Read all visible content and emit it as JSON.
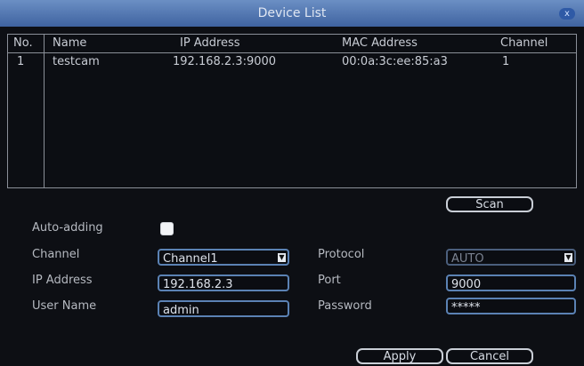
{
  "window": {
    "title": "Device List",
    "close_label": "x"
  },
  "table": {
    "headers": [
      "No.",
      "Name",
      "IP Address",
      "MAC Address",
      "Channel"
    ],
    "rows": [
      {
        "no": "1",
        "name": "testcam",
        "ip": "192.168.2.3:9000",
        "mac": "00:0a:3c:ee:85:a3",
        "channel": "1"
      }
    ]
  },
  "scan": {
    "label": "Scan"
  },
  "form": {
    "auto_adding_label": "Auto-adding",
    "channel_label": "Channel",
    "channel_value": "Channel1",
    "protocol_label": "Protocol",
    "protocol_value": "AUTO",
    "ip_label": "IP Address",
    "ip_value": "192.168.2.3",
    "port_label": "Port",
    "port_value": "9000",
    "user_label": "User Name",
    "user_value": "admin",
    "password_label": "Password",
    "password_value": "*****"
  },
  "actions": {
    "apply_label": "Apply",
    "cancel_label": "Cancel"
  },
  "colors": {
    "titlebar": "#4f74b0",
    "field_border": "#5b82b4",
    "background": "#0d0f14"
  }
}
